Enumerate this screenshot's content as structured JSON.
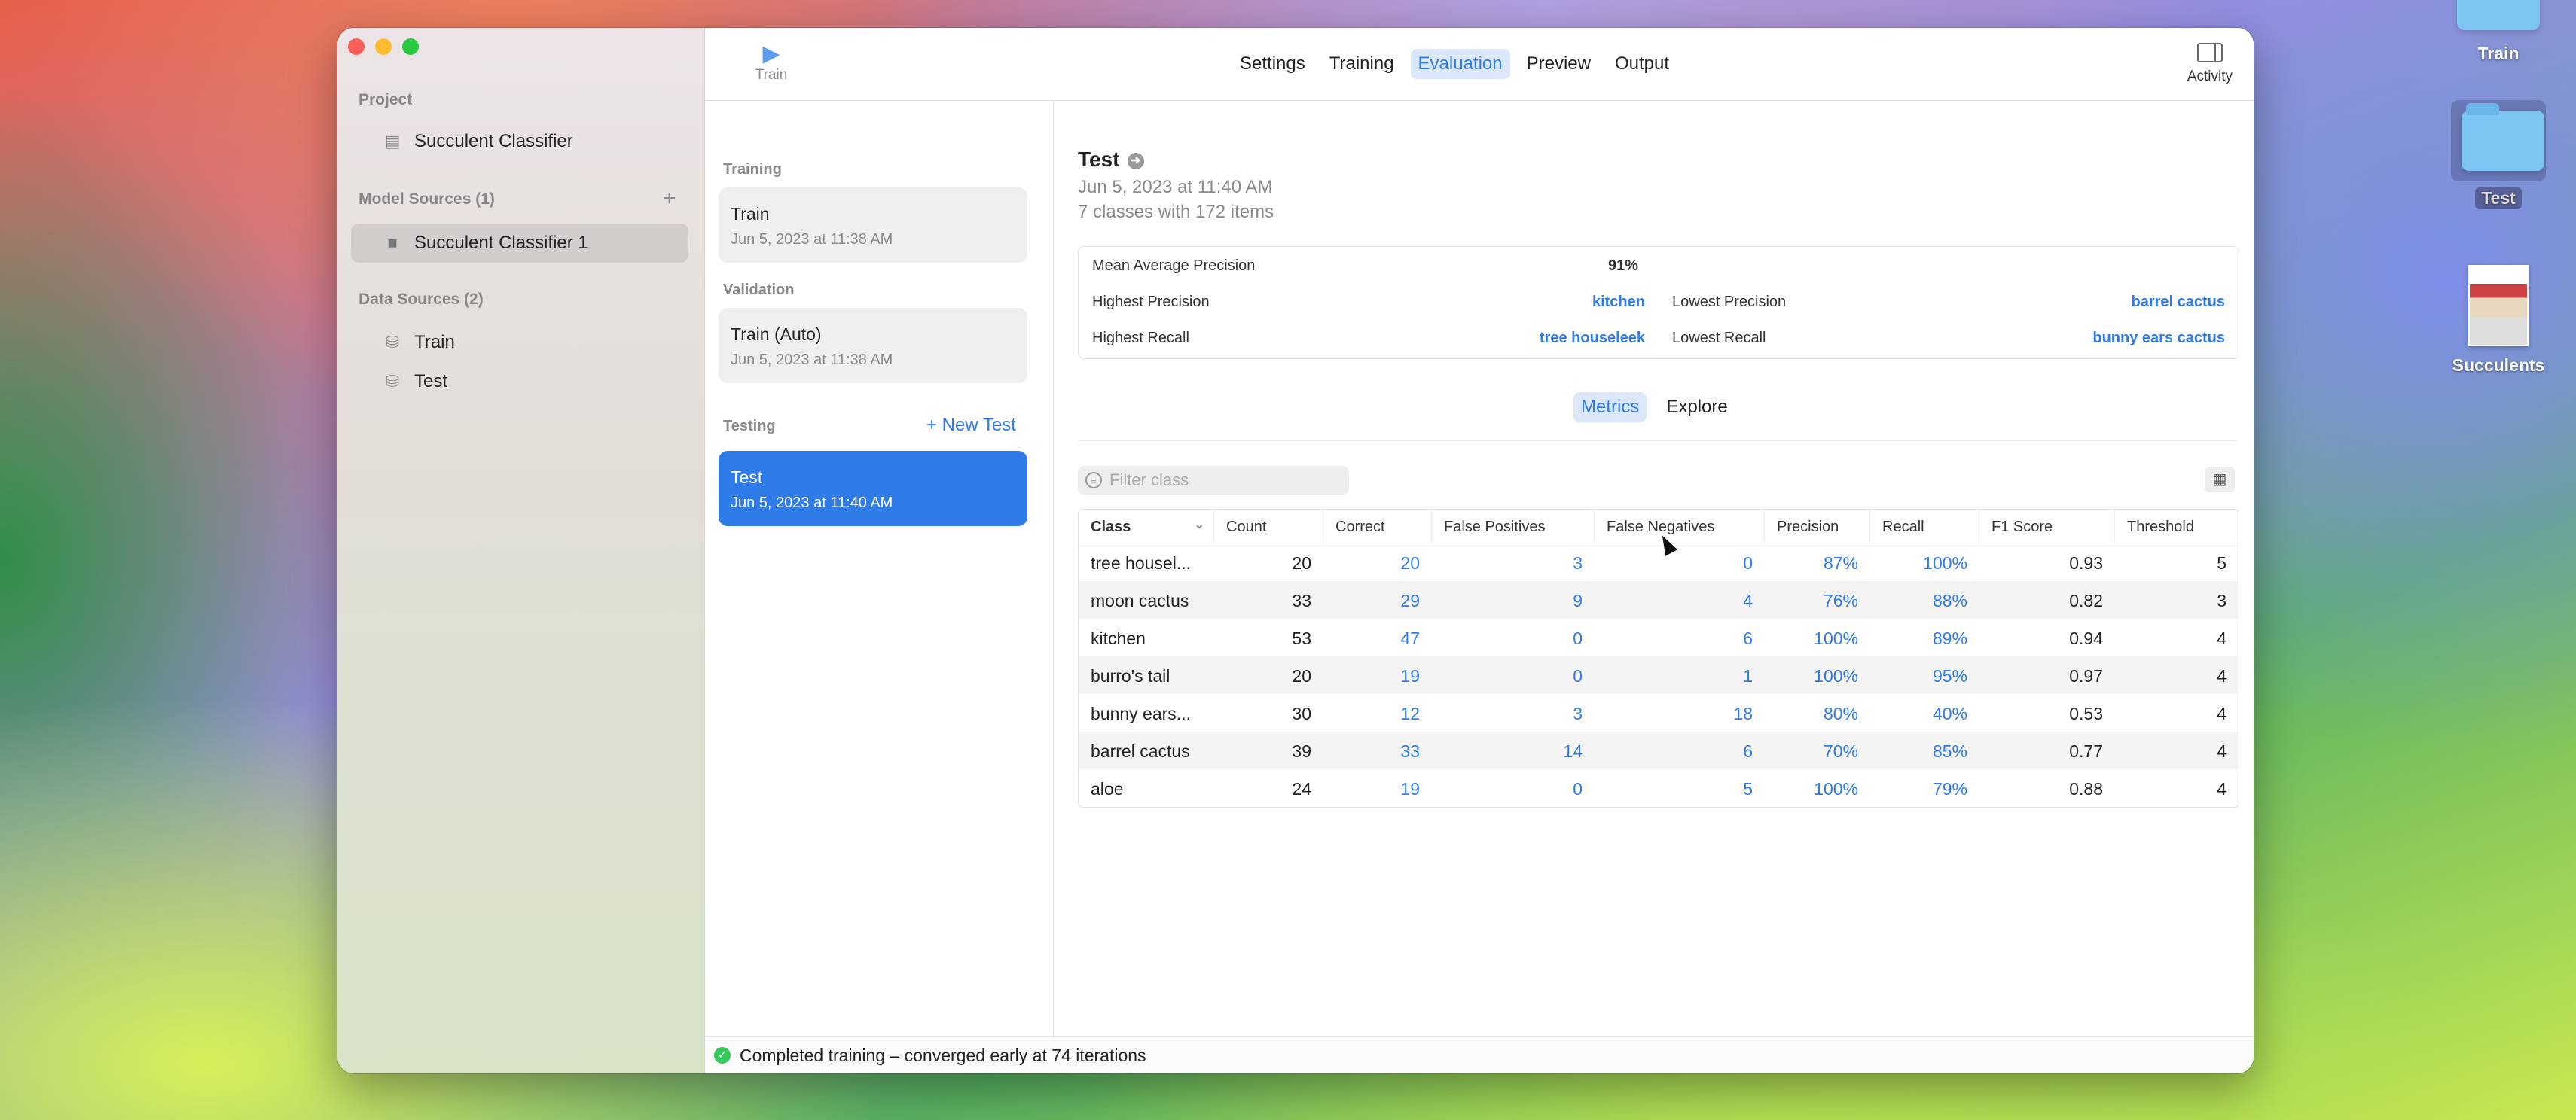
{
  "desktop": {
    "icons": [
      {
        "label": "Train"
      },
      {
        "label": "Test"
      },
      {
        "label": "Succulents"
      }
    ]
  },
  "sidebar": {
    "project_header": "Project",
    "project_item": "Succulent Classifier",
    "model_sources_header": "Model Sources (1)",
    "model_item": "Succulent Classifier 1",
    "data_sources_header": "Data Sources (2)",
    "data_items": [
      "Train",
      "Test"
    ]
  },
  "toolbar": {
    "train_label": "Train",
    "tabs": [
      "Settings",
      "Training",
      "Evaluation",
      "Preview",
      "Output"
    ],
    "active_tab": "Evaluation",
    "activity_label": "Activity"
  },
  "list": {
    "training_header": "Training",
    "training_item": {
      "title": "Train",
      "date": "Jun 5, 2023 at 11:38 AM"
    },
    "validation_header": "Validation",
    "validation_item": {
      "title": "Train (Auto)",
      "date": "Jun 5, 2023 at 11:38 AM"
    },
    "testing_header": "Testing",
    "new_test_label": "+ New Test",
    "testing_item": {
      "title": "Test",
      "date": "Jun 5, 2023 at 11:40 AM"
    }
  },
  "detail": {
    "title": "Test",
    "date": "Jun 5, 2023 at 11:40 AM",
    "summary_line": "7 classes with 172 items",
    "map_label": "Mean Average Precision",
    "map_value": "91%",
    "highest_precision_label": "Highest Precision",
    "highest_precision_value": "kitchen",
    "lowest_precision_label": "Lowest Precision",
    "lowest_precision_value": "barrel cactus",
    "highest_recall_label": "Highest Recall",
    "highest_recall_value": "tree houseleek",
    "lowest_recall_label": "Lowest Recall",
    "lowest_recall_value": "bunny ears cactus",
    "segment_metrics": "Metrics",
    "segment_explore": "Explore",
    "filter_placeholder": "Filter class"
  },
  "table": {
    "headers": [
      "Class",
      "Count",
      "Correct",
      "False Positives",
      "False Negatives",
      "Precision",
      "Recall",
      "F1 Score",
      "Threshold"
    ],
    "rows": [
      [
        "tree housel...",
        "20",
        "20",
        "3",
        "0",
        "87%",
        "100%",
        "0.93",
        "5"
      ],
      [
        "moon cactus",
        "33",
        "29",
        "9",
        "4",
        "76%",
        "88%",
        "0.82",
        "3"
      ],
      [
        "kitchen",
        "53",
        "47",
        "0",
        "6",
        "100%",
        "89%",
        "0.94",
        "4"
      ],
      [
        "burro's tail",
        "20",
        "19",
        "0",
        "1",
        "100%",
        "95%",
        "0.97",
        "4"
      ],
      [
        "bunny ears...",
        "30",
        "12",
        "3",
        "18",
        "80%",
        "40%",
        "0.53",
        "4"
      ],
      [
        "barrel cactus",
        "39",
        "33",
        "14",
        "6",
        "70%",
        "85%",
        "0.77",
        "4"
      ],
      [
        "aloe",
        "24",
        "19",
        "0",
        "5",
        "100%",
        "79%",
        "0.88",
        "4"
      ]
    ]
  },
  "status": {
    "text": "Completed training – converged early at 74 iterations"
  },
  "colors": {
    "accent": "#2f7ce8",
    "success": "#34c759"
  }
}
